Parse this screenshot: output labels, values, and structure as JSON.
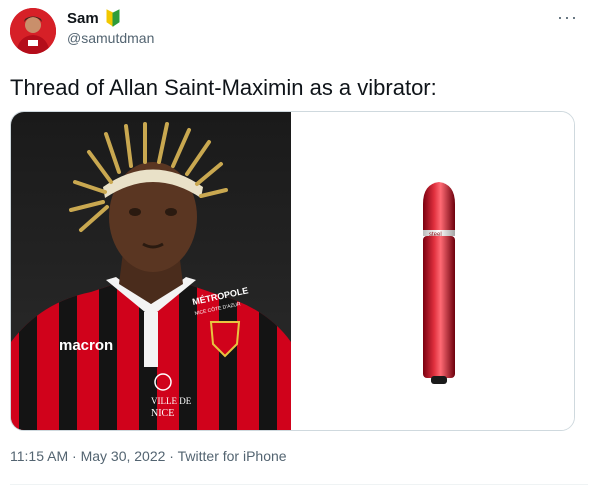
{
  "user": {
    "display_name": "Sam",
    "handle": "@samutdman",
    "badge_icon": "beginner-leaf-icon"
  },
  "tweet": {
    "text": "Thread of Allan Saint-Maximin as a vibrator:"
  },
  "media": {
    "left_kit": {
      "sponsor": "macron",
      "chest": "MÉTROPOLE",
      "chest_sub": "NICE CÔTE D'AZUR",
      "crest_text": "VILLE DE",
      "crest_text2": "NICE"
    },
    "right_device": {
      "label": "steel"
    }
  },
  "meta": {
    "time": "11:15 AM",
    "date": "May 30, 2022",
    "source": "Twitter for iPhone",
    "separator": " · "
  },
  "colors": {
    "text": "#0f1419",
    "secondary": "#536471",
    "border": "#cfd9de",
    "kit_red": "#d0021b",
    "kit_black": "#141414"
  }
}
